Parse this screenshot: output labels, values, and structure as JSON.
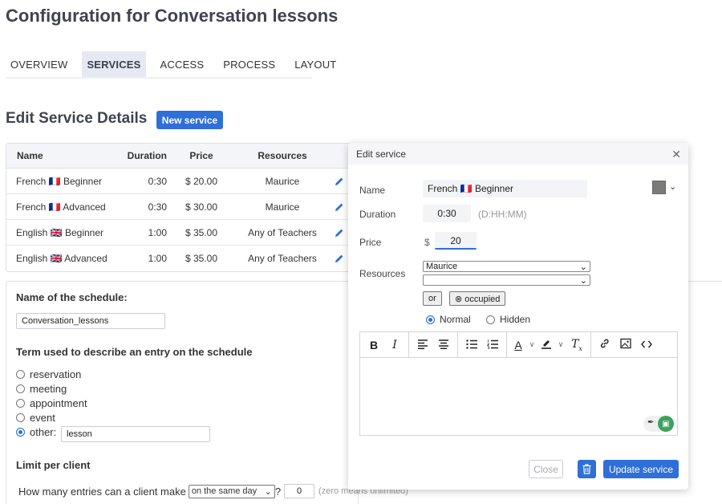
{
  "page": {
    "title": "Configuration for Conversation lessons"
  },
  "tabs": [
    {
      "label": "OVERVIEW",
      "active": false
    },
    {
      "label": "SERVICES",
      "active": true
    },
    {
      "label": "ACCESS",
      "active": false
    },
    {
      "label": "PROCESS",
      "active": false
    },
    {
      "label": "LAYOUT",
      "active": false
    }
  ],
  "services": {
    "title": "Edit Service Details",
    "new_button": "New service",
    "columns": [
      "Name",
      "Duration",
      "Price",
      "Resources"
    ],
    "rows": [
      {
        "name": "French 🇫🇷 Beginner",
        "duration": "0:30",
        "price": "$ 20.00",
        "resources": "Maurice"
      },
      {
        "name": "French 🇫🇷 Advanced",
        "duration": "0:30",
        "price": "$ 30.00",
        "resources": "Maurice"
      },
      {
        "name": "English 🇬🇧 Beginner",
        "duration": "1:00",
        "price": "$ 35.00",
        "resources": "Any of Teachers"
      },
      {
        "name": "English 🇬🇧 Advanced",
        "duration": "1:00",
        "price": "$ 35.00",
        "resources": "Any of Teachers"
      }
    ]
  },
  "schedule": {
    "name_label": "Name of the schedule:",
    "name_value": "Conversation_lessons",
    "term_label": "Term used to describe an entry on the schedule",
    "term_options": [
      {
        "label": "reservation",
        "checked": false
      },
      {
        "label": "meeting",
        "checked": false
      },
      {
        "label": "appointment",
        "checked": false
      },
      {
        "label": "event",
        "checked": false
      },
      {
        "label": "other:",
        "checked": true
      }
    ],
    "other_value": "lesson",
    "limit_label": "Limit per client",
    "limit_question": "How many entries can a client make",
    "limit_period": "on the same day",
    "limit_qmark": "?",
    "limit_value": "0",
    "limit_note": "(zero means unlimited)"
  },
  "modal": {
    "title": "Edit service",
    "close_glyph": "✕",
    "name_label": "Name",
    "name_value": "French 🇫🇷 Beginner",
    "color": "#7b7b78",
    "duration_label": "Duration",
    "duration_value": "0:30",
    "duration_hint": "(D:HH:MM)",
    "price_label": "Price",
    "currency": "$",
    "price_value": "20",
    "resources_label": "Resources",
    "resource_1": "Maurice",
    "resource_2": "",
    "or_button": "or",
    "occupied_button": "⊗ occupied",
    "visibility": [
      {
        "label": "Normal",
        "checked": true
      },
      {
        "label": "Hidden",
        "checked": false
      }
    ],
    "close_button": "Close",
    "update_button": "Update service"
  }
}
